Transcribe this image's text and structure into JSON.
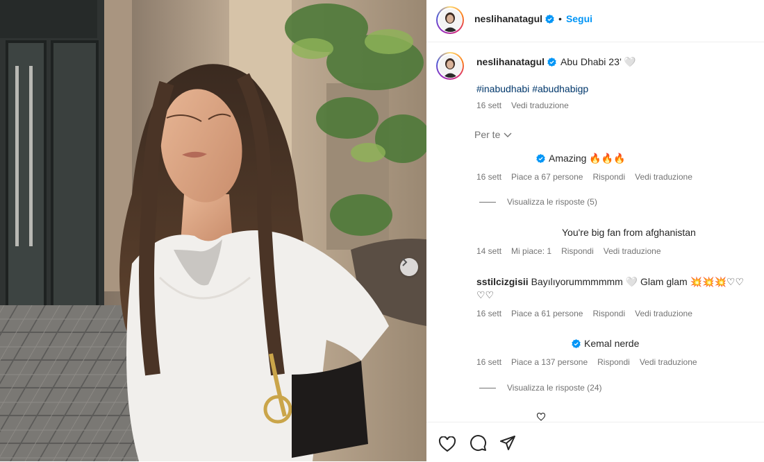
{
  "post": {
    "username": "neslihanatagul",
    "follow_label": "Segui",
    "dot": "•",
    "caption_text": "Abu Dhabi 23’ 🤍",
    "hashtags": [
      "#inabudhabi",
      "#abudhabigp"
    ],
    "time": "16 sett",
    "translate_label": "Vedi traduzione"
  },
  "sort": {
    "label": "Per te"
  },
  "comments": [
    {
      "text": "Amazing 🔥🔥🔥",
      "time": "16 sett",
      "likes": "Piace a 67 persone",
      "reply": "Rispondi",
      "translate": "Vedi traduzione",
      "view_replies": "Visualizza le risposte (5)"
    },
    {
      "text": "You're big fan from afghanistan",
      "time": "14 sett",
      "likes": "Mi piace: 1",
      "reply": "Rispondi",
      "translate": "Vedi traduzione"
    },
    {
      "username": "sstilcizgisii",
      "text": "Bayılıyorummmmmm 🤍 Glam glam 💥💥💥♡♡",
      "text_line2": "♡♡",
      "time": "16 sett",
      "likes": "Piace a 61 persone",
      "reply": "Rispondi",
      "translate": "Vedi traduzione"
    },
    {
      "text": "Kemal nerde",
      "time": "16 sett",
      "likes": "Piace a 137 persone",
      "reply": "Rispondi",
      "translate": "Vedi traduzione",
      "view_replies": "Visualizza le risposte (24)"
    }
  ],
  "icons": {
    "verified": "verified-badge-icon",
    "carousel_next": "chevron-right-icon",
    "like": "heart-icon",
    "comment": "comment-icon",
    "share": "share-icon"
  },
  "colors": {
    "accent": "#0095f6",
    "hashtag": "#00376b",
    "muted": "#737373",
    "text": "#262626"
  }
}
